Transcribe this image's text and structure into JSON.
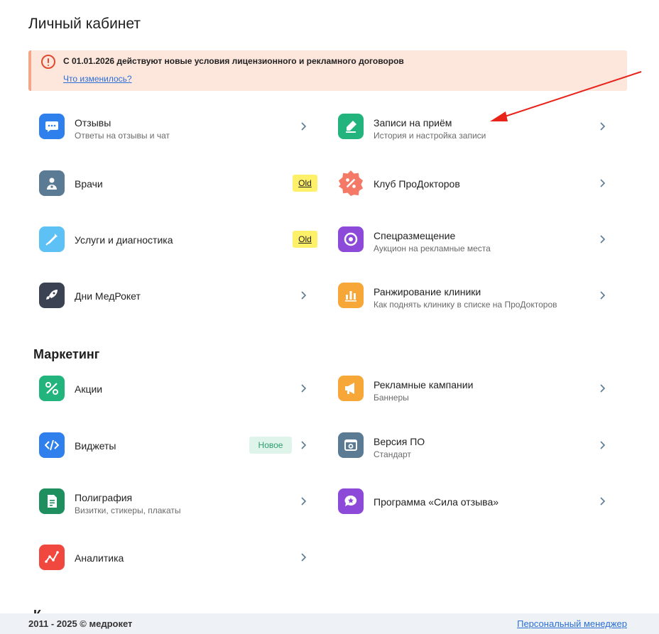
{
  "page": {
    "title": "Личный кабинет"
  },
  "notice": {
    "text": "С 01.01.2026 действуют новые условия лицензионного и рекламного договоров",
    "link": "Что изменилось?"
  },
  "main_items": {
    "reviews": {
      "title": "Отзывы",
      "subtitle": "Ответы на отзывы и чат",
      "icon": "chat-icon",
      "color": "#2f80ed"
    },
    "appointments": {
      "title": "Записи на приём",
      "subtitle": "История и настройка записи",
      "icon": "pen-icon",
      "color": "#22b47c"
    },
    "doctors": {
      "title": "Врачи",
      "badge": "Old",
      "icon": "doctor-icon",
      "color": "#5b7a94"
    },
    "club": {
      "title": "Клуб ПроДокторов",
      "icon": "percent-badge-icon",
      "color": "#f47a67"
    },
    "services": {
      "title": "Услуги и диагностика",
      "badge": "Old",
      "icon": "syringe-icon",
      "color": "#5ec1f5"
    },
    "placement": {
      "title": "Спецразмещение",
      "subtitle": "Аукцион на рекламные места",
      "icon": "target-icon",
      "color": "#8d4ad9"
    },
    "medrocket_days": {
      "title": "Дни МедРокет",
      "icon": "rocket-icon",
      "color": "#3b4252"
    },
    "ranking": {
      "title": "Ранжирование клиники",
      "subtitle": "Как поднять клинику в списке на ПроДокторов",
      "icon": "bar-chart-icon",
      "color": "#f7a638"
    }
  },
  "marketing": {
    "title": "Маркетинг",
    "promos": {
      "title": "Акции",
      "icon": "percent-icon",
      "color": "#22b47c"
    },
    "campaigns": {
      "title": "Рекламные кампании",
      "subtitle": "Баннеры",
      "icon": "megaphone-icon",
      "color": "#f7a638"
    },
    "widgets": {
      "title": "Виджеты",
      "badge": "Новое",
      "icon": "code-icon",
      "color": "#2f80ed"
    },
    "version": {
      "title": "Версия ПО",
      "subtitle": "Стандарт",
      "icon": "settings-window-icon",
      "color": "#5b7a94"
    },
    "printing": {
      "title": "Полиграфия",
      "subtitle": "Визитки, стикеры, плакаты",
      "icon": "document-icon",
      "color": "#1f8f5f"
    },
    "review_power": {
      "title": "Программа «Сила отзыва»",
      "icon": "chat-star-icon",
      "color": "#8d4ad9"
    },
    "analytics": {
      "title": "Аналитика",
      "icon": "line-chart-icon",
      "color": "#f0483e"
    }
  },
  "next_section": {
    "title": "К"
  },
  "footer": {
    "copyright": "2011 - 2025 © медрокет",
    "manager_link": "Персональный менеджер"
  },
  "colors": {
    "accent_red": "#e8231a",
    "link": "#2b6fd6",
    "notice_bg": "#fde6dc"
  }
}
